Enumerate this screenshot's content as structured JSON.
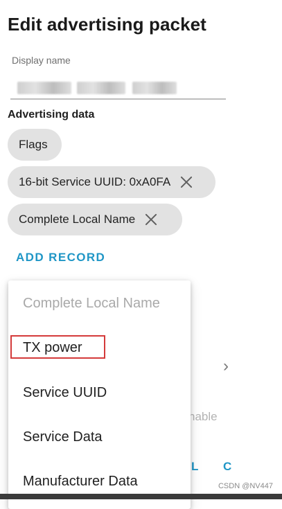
{
  "dialog": {
    "title": "Edit advertising packet",
    "display_name_label": "Display name",
    "section_heading": "Advertising data",
    "add_record": "ADD RECORD"
  },
  "records": [
    {
      "label": "Flags",
      "removable": false
    },
    {
      "label": "16-bit Service UUID: 0xA0FA",
      "removable": true
    },
    {
      "label": "Complete Local Name",
      "removable": true
    }
  ],
  "menu": {
    "items": [
      {
        "label": "Complete Local Name",
        "enabled": false
      },
      {
        "label": "TX power",
        "enabled": true,
        "highlighted": true
      },
      {
        "label": "Service UUID",
        "enabled": true
      },
      {
        "label": "Service Data",
        "enabled": true
      },
      {
        "label": "Manufacturer Data",
        "enabled": true
      }
    ]
  },
  "background": {
    "partial_text": "nable",
    "chevron": "›",
    "button_fragment_1": "L",
    "button_fragment_2": "C"
  },
  "watermark": "CSDN @NV447",
  "colors": {
    "accent": "#1f96c6",
    "chip_background": "#e2e2e2",
    "highlight_border": "#d43a3a"
  }
}
